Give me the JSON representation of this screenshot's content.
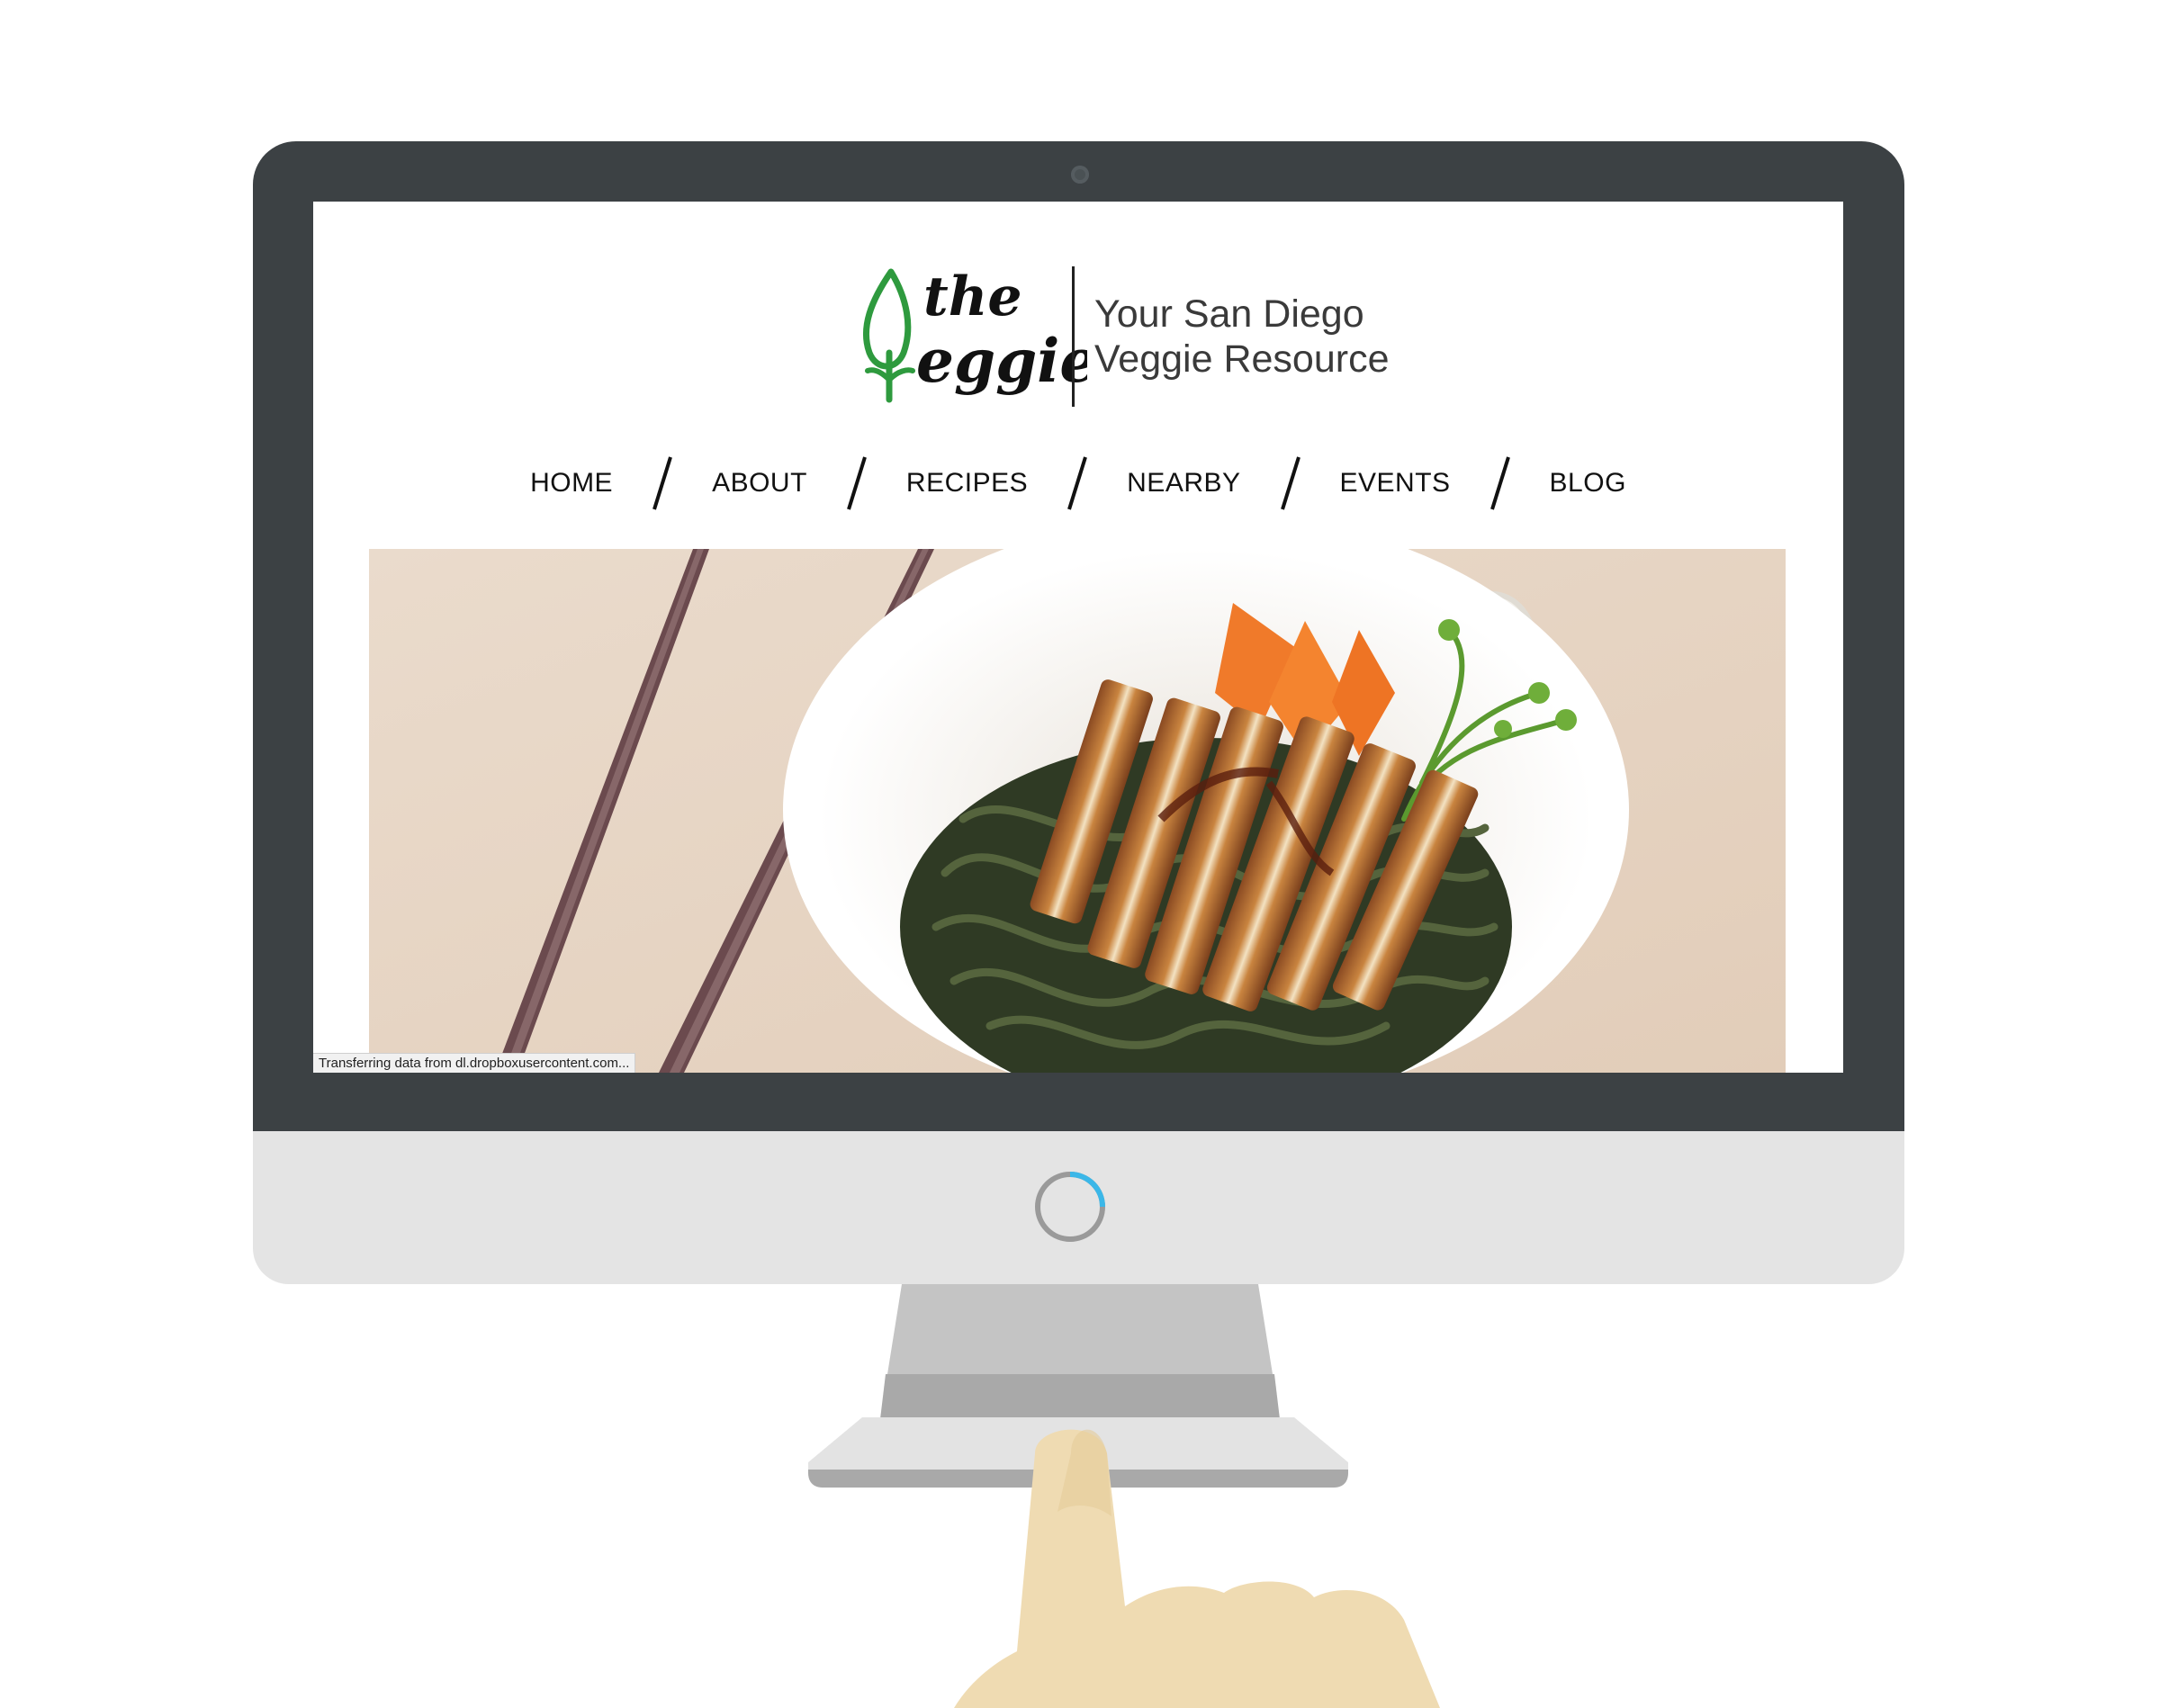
{
  "brand": {
    "logo_text": "the Veggie",
    "tagline_line1": "Your San Diego",
    "tagline_line2": "Veggie Resource",
    "logo_color": "#2e9a3e"
  },
  "nav": {
    "items": [
      {
        "label": "HOME"
      },
      {
        "label": "ABOUT"
      },
      {
        "label": "RECIPES"
      },
      {
        "label": "NEARBY"
      },
      {
        "label": "EVENTS"
      },
      {
        "label": "BLOG"
      }
    ]
  },
  "hero": {
    "icon": "food-photo-icon"
  },
  "status_bar": {
    "text": "Transferring data from dl.dropboxusercontent.com..."
  },
  "device": {
    "bezel_color": "#3c4144",
    "chin_color": "#e4e4e4",
    "loading_accent": "#3bb7e8"
  }
}
